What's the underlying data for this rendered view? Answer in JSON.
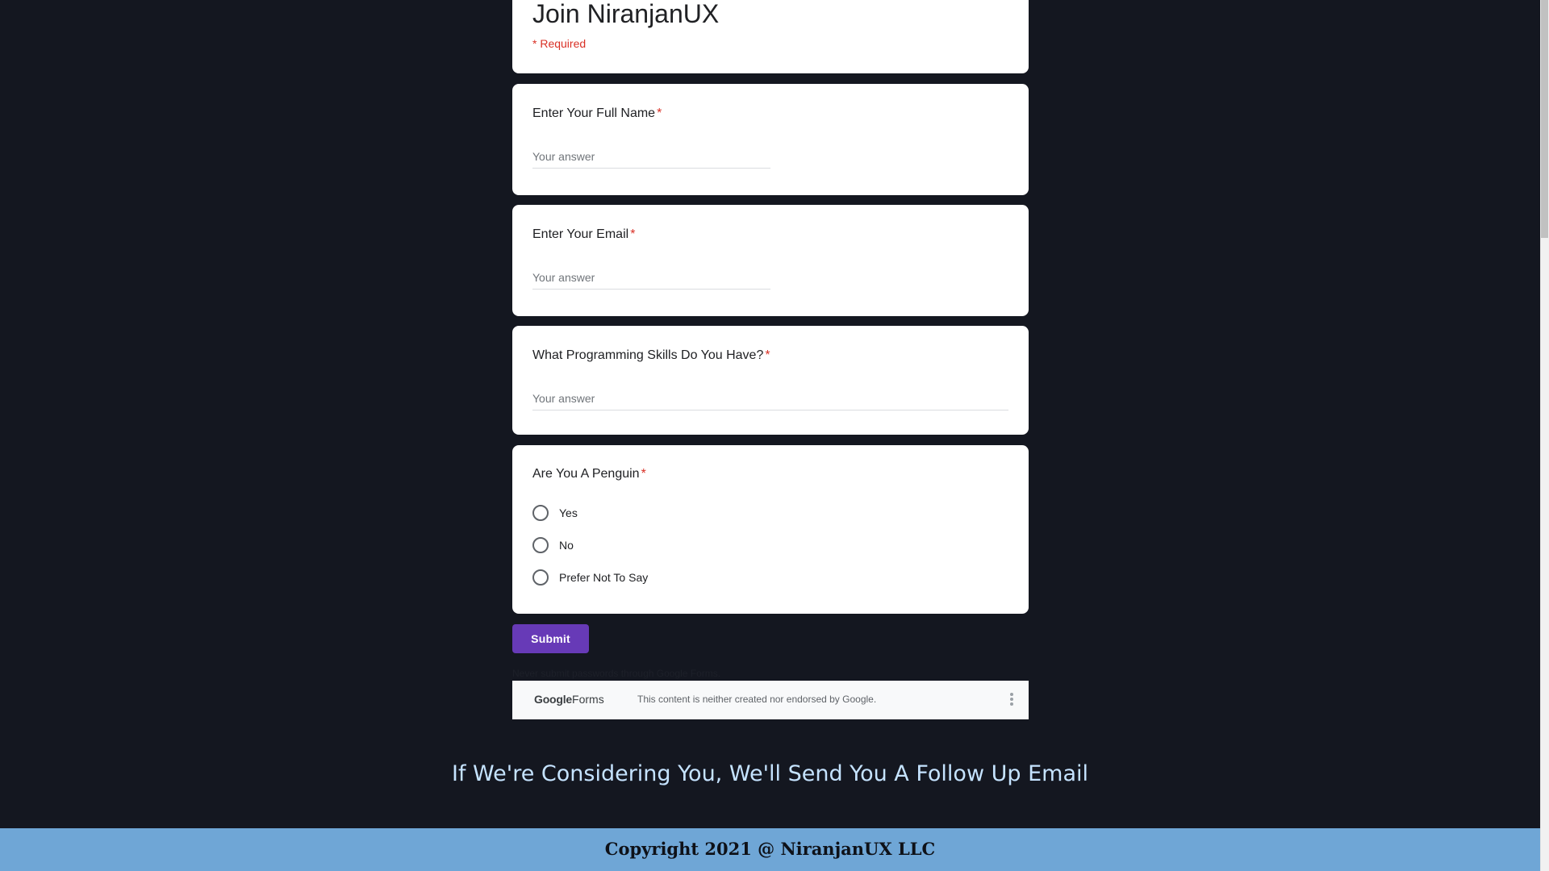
{
  "form": {
    "title": "Join NiranjanUX",
    "required_note": "* Required",
    "questions": [
      {
        "label": "Enter Your Full Name",
        "required_mark": "*",
        "placeholder": "Your answer",
        "value": ""
      },
      {
        "label": "Enter Your Email",
        "required_mark": "*",
        "placeholder": "Your answer",
        "value": ""
      },
      {
        "label": "What Programming Skills Do You Have?",
        "required_mark": "*",
        "placeholder": "Your answer",
        "value": ""
      },
      {
        "label": "Are You A Penguin",
        "required_mark": "*",
        "options": [
          "Yes",
          "No",
          "Prefer Not To Say"
        ],
        "selected": null
      }
    ],
    "submit_label": "Submit",
    "never_submit_note": "Never submit passwords through Google Forms."
  },
  "google_forms_bar": {
    "logo_google": "Google",
    "logo_forms": "Forms",
    "disclaimer": "This content is neither created nor endorsed by Google.",
    "menu_icon": "more-vert-icon"
  },
  "follow_up_message": "If We're Considering You, We'll Send You A Follow Up Email",
  "footer": {
    "copyright": "Copyright 2021 @ NiranjanUX LLC"
  },
  "colors": {
    "page_background": "#141720",
    "accent": "#673ab7",
    "required": "#d93025",
    "footer_background": "#6fa6d6",
    "follow_up_text": "#c5e3ff"
  }
}
